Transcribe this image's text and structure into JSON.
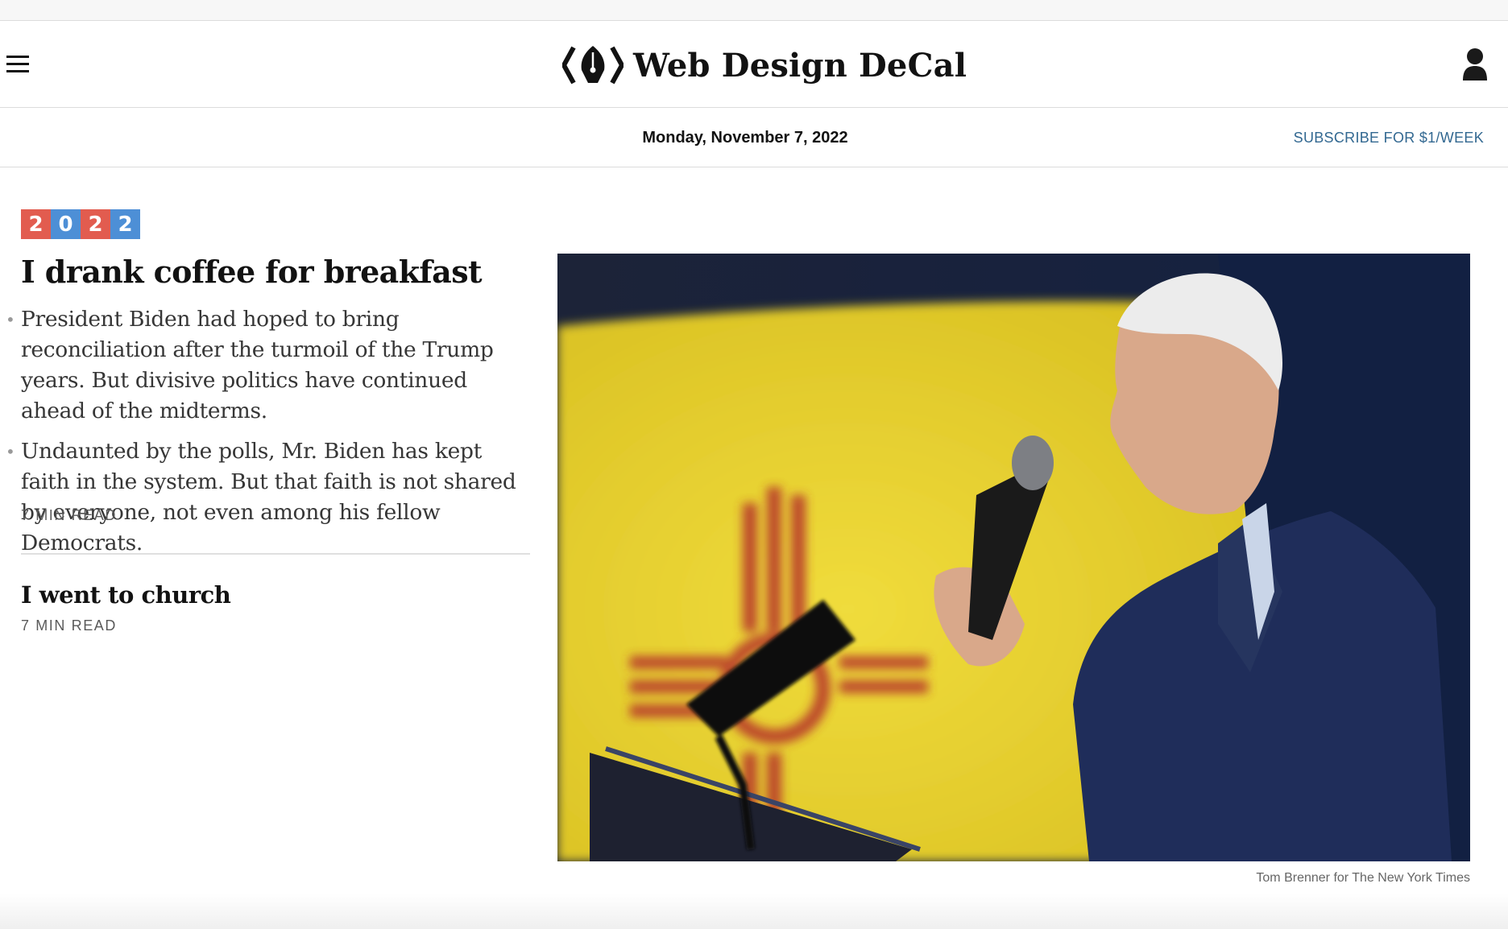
{
  "header": {
    "title": "Web Design DeCal",
    "menu_icon": "hamburger-menu-icon",
    "account_icon": "user-account-icon",
    "logo_icon": "pen-nib-code-brackets-logo"
  },
  "subheader": {
    "date": "Monday, November 7, 2022",
    "subscribe_label": "SUBSCRIBE FOR $1/WEEK"
  },
  "colors": {
    "badge_red": "#e25c4f",
    "badge_blue": "#4d8fd6",
    "link_blue": "#326891"
  },
  "lead_story": {
    "badge_digits": [
      "2",
      "0",
      "2",
      "2"
    ],
    "headline": "I drank coffee for breakfast",
    "summary": [
      "President Biden had hoped to bring reconciliation after the turmoil of the Trump years. But divisive politics have continued ahead of the midterms.",
      "Undaunted by the polls, Mr. Biden has kept faith in the system. But that faith is not shared by everyone, not even among his fellow Democrats."
    ],
    "read_time": "7 MIN READ",
    "image_credit": "Tom Brenner for The New York Times"
  },
  "second_story": {
    "headline": "I went to church",
    "read_time": "7 MIN READ"
  }
}
